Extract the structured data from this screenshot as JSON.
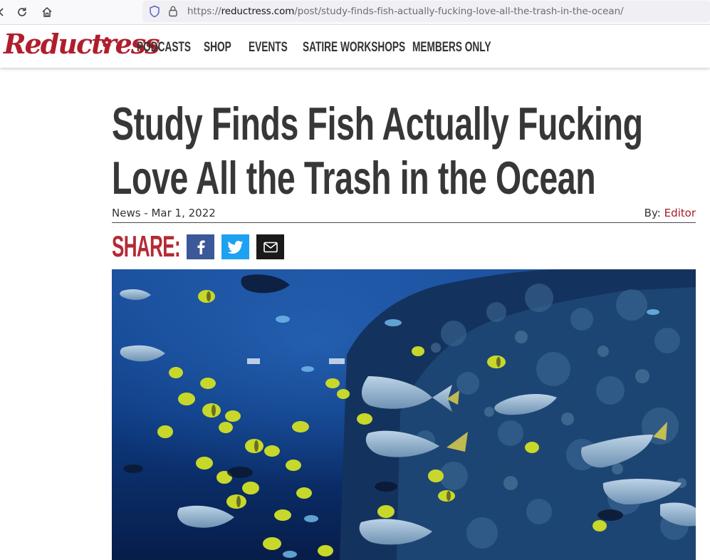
{
  "browser": {
    "url_prefix": "https://",
    "url_host": "reductress.com",
    "url_path": "/post/study-finds-fish-actually-fucking-love-all-the-trash-in-the-ocean/"
  },
  "site": {
    "logo_text": "Reductress",
    "nav": [
      "PODCASTS",
      "SHOP",
      "EVENTS",
      "SATIRE WORKSHOPS",
      "MEMBERS ONLY"
    ],
    "brand_color": "#b01e2d"
  },
  "article": {
    "headline": "Study Finds Fish Actually Fucking Love All the Trash in the Ocean",
    "category_date": "News - Mar 1, 2022",
    "by_label": "By:",
    "author": "Editor",
    "share_label": "SHARE:",
    "share_buttons": [
      {
        "icon": "facebook-icon",
        "color": "#3b5998"
      },
      {
        "icon": "twitter-icon",
        "color": "#1da1f2"
      },
      {
        "icon": "email-icon",
        "color": "#1a1a1a"
      }
    ],
    "hero_image": "aquarium with tropical fish and coral reef"
  }
}
